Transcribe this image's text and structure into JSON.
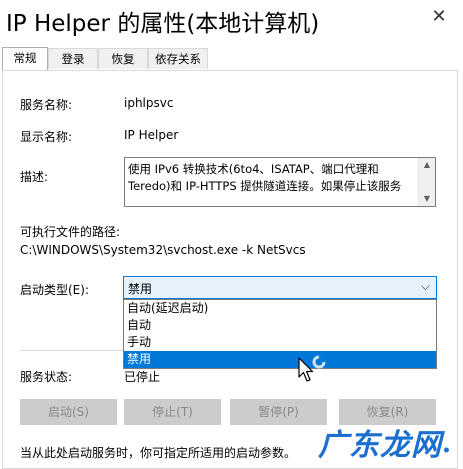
{
  "window": {
    "title": "IP Helper 的属性(本地计算机)",
    "close_glyph": "✕"
  },
  "tabs": [
    {
      "label": "常规",
      "active": true
    },
    {
      "label": "登录",
      "active": false
    },
    {
      "label": "恢复",
      "active": false
    },
    {
      "label": "依存关系",
      "active": false
    }
  ],
  "general": {
    "service_name_label": "服务名称:",
    "service_name_value": "iphlpsvc",
    "display_name_label": "显示名称:",
    "display_name_value": "IP Helper",
    "description_label": "描述:",
    "description_value": "使用 IPv6 转换技术(6to4、ISATAP、端口代理和 Teredo)和 IP-HTTPS 提供隧道连接。如果停止该服务",
    "exe_path_label": "可执行文件的路径:",
    "exe_path_value": "C:\\WINDOWS\\System32\\svchost.exe -k NetSvcs",
    "startup_type_label": "启动类型(E):",
    "startup_type_selected": "禁用",
    "startup_type_options": [
      "自动(延迟启动)",
      "自动",
      "手动",
      "禁用"
    ],
    "service_status_label": "服务状态:",
    "service_status_value": "已停止",
    "buttons": {
      "start": "启动(S)",
      "stop": "停止(T)",
      "pause": "暂停(P)",
      "resume": "恢复(R)"
    },
    "hint": "当从此处启动服务时，你可指定所适用的启动参数。"
  },
  "watermark": {
    "text": "广东龙网",
    "dot": "•"
  },
  "colors": {
    "accent": "#0078d7",
    "select_bg": "#e5f1fb",
    "disabled_button": "#cccccc",
    "watermark": "#1b6fd0"
  },
  "icons": {
    "close": "close-icon",
    "dropdown": "chevron-down-icon",
    "cursor": "arrow-cursor-icon",
    "busy": "busy-spinner-icon"
  }
}
